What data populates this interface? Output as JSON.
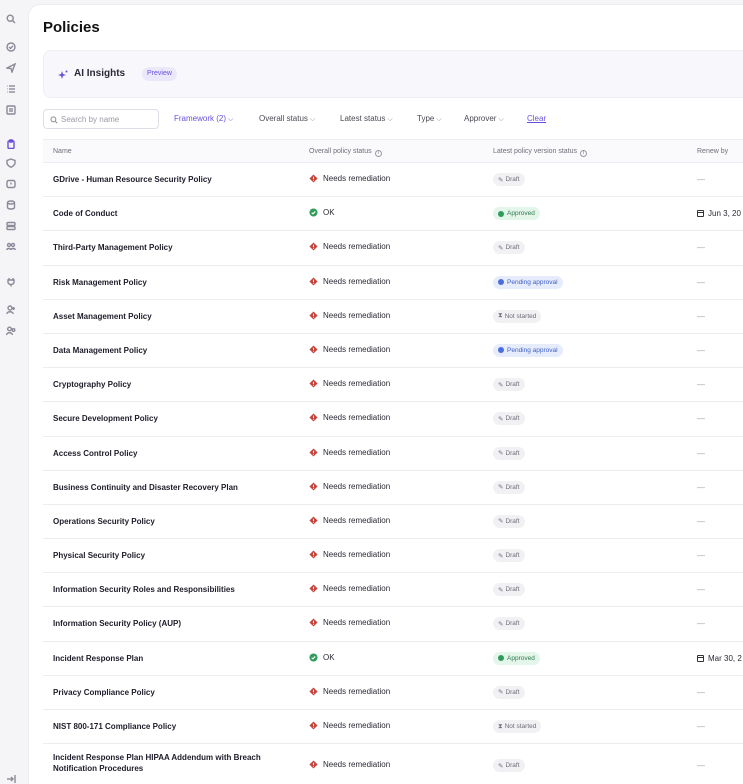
{
  "page": {
    "title": "Policies"
  },
  "rail": {
    "icons": [
      "search-icon",
      "check-circle-icon",
      "send-icon",
      "list-icon",
      "grid-icon",
      "clipboard-icon",
      "shield-icon",
      "alert-icon",
      "database-icon",
      "layers-icon",
      "people-icon",
      "plug-icon",
      "user-add-icon",
      "user-group-icon",
      "exit-icon"
    ],
    "active_index": 5
  },
  "insights": {
    "label": "AI Insights",
    "badge": "Preview"
  },
  "filters": {
    "search_placeholder": "Search by name",
    "framework": "Framework (2)",
    "overall_status": "Overall status",
    "latest_status": "Latest status",
    "type": "Type",
    "approver": "Approver",
    "clear": "Clear"
  },
  "table": {
    "columns": {
      "name": "Name",
      "overall": "Overall policy status",
      "version": "Latest policy version status",
      "renew": "Renew by"
    },
    "rows": [
      {
        "name": "GDrive - Human Resource Security Policy",
        "status": "Needs remediation",
        "status_kind": "needs",
        "version": "Draft",
        "version_kind": "draft",
        "renew": "—"
      },
      {
        "name": "Code of Conduct",
        "status": "OK",
        "status_kind": "ok",
        "version": "Approved",
        "version_kind": "approved",
        "renew": "Jun 3, 20"
      },
      {
        "name": "Third-Party Management Policy",
        "status": "Needs remediation",
        "status_kind": "needs",
        "version": "Draft",
        "version_kind": "draft",
        "renew": "—"
      },
      {
        "name": "Risk Management Policy",
        "status": "Needs remediation",
        "status_kind": "needs",
        "version": "Pending approval",
        "version_kind": "pending",
        "renew": "—"
      },
      {
        "name": "Asset Management Policy",
        "status": "Needs remediation",
        "status_kind": "needs",
        "version": "Not started",
        "version_kind": "notstarted",
        "renew": "—"
      },
      {
        "name": "Data Management Policy",
        "status": "Needs remediation",
        "status_kind": "needs",
        "version": "Pending approval",
        "version_kind": "pending",
        "renew": "—"
      },
      {
        "name": "Cryptography Policy",
        "status": "Needs remediation",
        "status_kind": "needs",
        "version": "Draft",
        "version_kind": "draft",
        "renew": "—"
      },
      {
        "name": "Secure Development Policy",
        "status": "Needs remediation",
        "status_kind": "needs",
        "version": "Draft",
        "version_kind": "draft",
        "renew": "—"
      },
      {
        "name": "Access Control Policy",
        "status": "Needs remediation",
        "status_kind": "needs",
        "version": "Draft",
        "version_kind": "draft",
        "renew": "—"
      },
      {
        "name": "Business Continuity and Disaster Recovery Plan",
        "status": "Needs remediation",
        "status_kind": "needs",
        "version": "Draft",
        "version_kind": "draft",
        "renew": "—"
      },
      {
        "name": "Operations Security Policy",
        "status": "Needs remediation",
        "status_kind": "needs",
        "version": "Draft",
        "version_kind": "draft",
        "renew": "—"
      },
      {
        "name": "Physical Security Policy",
        "status": "Needs remediation",
        "status_kind": "needs",
        "version": "Draft",
        "version_kind": "draft",
        "renew": "—"
      },
      {
        "name": "Information Security Roles and Responsibilities",
        "status": "Needs remediation",
        "status_kind": "needs",
        "version": "Draft",
        "version_kind": "draft",
        "renew": "—"
      },
      {
        "name": "Information Security Policy (AUP)",
        "status": "Needs remediation",
        "status_kind": "needs",
        "version": "Draft",
        "version_kind": "draft",
        "renew": "—"
      },
      {
        "name": "Incident Response Plan",
        "status": "OK",
        "status_kind": "ok",
        "version": "Approved",
        "version_kind": "approved",
        "renew": "Mar 30, 2"
      },
      {
        "name": "Privacy Compliance Policy",
        "status": "Needs remediation",
        "status_kind": "needs",
        "version": "Draft",
        "version_kind": "draft",
        "renew": "—"
      },
      {
        "name": "NIST 800-171 Compliance Policy",
        "status": "Needs remediation",
        "status_kind": "needs",
        "version": "Not started",
        "version_kind": "notstarted",
        "renew": "—"
      },
      {
        "name": "Incident Response Plan HIPAA Addendum with Breach Notification Procedures",
        "status": "Needs remediation",
        "status_kind": "needs",
        "version": "Draft",
        "version_kind": "draft",
        "renew": "—",
        "tall": true
      }
    ]
  },
  "colors": {
    "accent": "#6b4fe0",
    "needs_remediation": "#c4433a",
    "ok": "#2f9c5a"
  }
}
